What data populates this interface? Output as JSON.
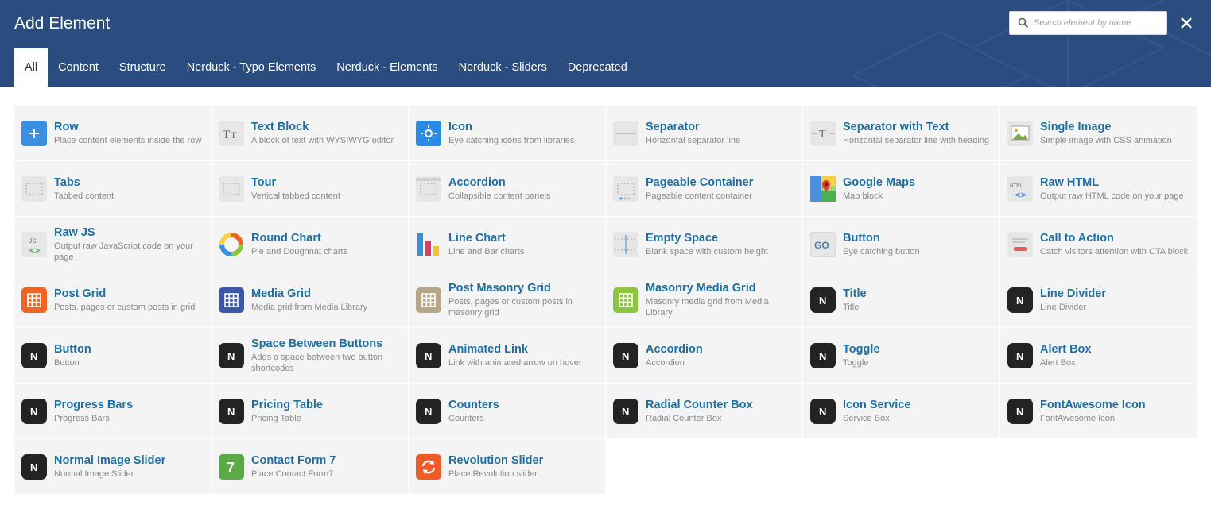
{
  "header": {
    "title": "Add Element",
    "search_placeholder": "Search element by name",
    "tabs": [
      "All",
      "Content",
      "Structure",
      "Nerduck - Typo Elements",
      "Nerduck - Elements",
      "Nerduck - Sliders",
      "Deprecated"
    ],
    "active_tab": "All",
    "background_color": "#2b4c7e"
  },
  "elements": [
    {
      "name": "Row",
      "desc": "Place content elements inside the row",
      "icon": "plus-icon",
      "color": "#3a8fe0"
    },
    {
      "name": "Text Block",
      "desc": "A block of text with WYSIWYG editor",
      "icon": "text-block-icon",
      "color": "#e6e6e6"
    },
    {
      "name": "Icon",
      "desc": "Eye catching icons from libraries",
      "icon": "sun-icon",
      "color": "#2a8be6"
    },
    {
      "name": "Separator",
      "desc": "Horizontal separator line",
      "icon": "separator-icon",
      "color": "#e6e6e6"
    },
    {
      "name": "Separator with Text",
      "desc": "Horizontal separator line with heading",
      "icon": "separator-text-icon",
      "color": "#e6e6e6"
    },
    {
      "name": "Single Image",
      "desc": "Simple image with CSS animation",
      "icon": "image-icon",
      "color": "#e6e6e6"
    },
    {
      "name": "Tabs",
      "desc": "Tabbed content",
      "icon": "tabs-icon",
      "color": "#e6e6e6"
    },
    {
      "name": "Tour",
      "desc": "Vertical tabbed content",
      "icon": "tour-icon",
      "color": "#e6e6e6"
    },
    {
      "name": "Accordion",
      "desc": "Collapsible content panels",
      "icon": "accordion-icon",
      "color": "#e6e6e6"
    },
    {
      "name": "Pageable Container",
      "desc": "Pageable content container",
      "icon": "pageable-icon",
      "color": "#e6e6e6"
    },
    {
      "name": "Google Maps",
      "desc": "Map block",
      "icon": "google-maps-icon",
      "color": "#4caf50"
    },
    {
      "name": "Raw HTML",
      "desc": "Output raw HTML code on your page",
      "icon": "html-icon",
      "color": "#e6e6e6"
    },
    {
      "name": "Raw JS",
      "desc": "Output raw JavaScript code on your page",
      "icon": "js-icon",
      "color": "#e6e6e6"
    },
    {
      "name": "Round Chart",
      "desc": "Pie and Doughnat charts",
      "icon": "round-chart-icon",
      "color": "#e6e6e6"
    },
    {
      "name": "Line Chart",
      "desc": "Line and Bar charts",
      "icon": "bar-chart-icon",
      "color": "#e6e6e6"
    },
    {
      "name": "Empty Space",
      "desc": "Blank space with custom height",
      "icon": "empty-space-icon",
      "color": "#e6e6e6"
    },
    {
      "name": "Button",
      "desc": "Eye catching button",
      "icon": "go-button-icon",
      "color": "#e6e6e6"
    },
    {
      "name": "Call to Action",
      "desc": "Catch visitors attention with CTA block",
      "icon": "cta-icon",
      "color": "#e6e6e6"
    },
    {
      "name": "Post Grid",
      "desc": "Posts, pages or custom posts in grid",
      "icon": "post-grid-icon",
      "color": "#f06424"
    },
    {
      "name": "Media Grid",
      "desc": "Media grid from Media Library",
      "icon": "media-grid-icon",
      "color": "#3b57a8"
    },
    {
      "name": "Post Masonry Grid",
      "desc": "Posts, pages or custom posts in masonry grid",
      "icon": "masonry-grid-icon",
      "color": "#b8a689"
    },
    {
      "name": "Masonry Media Grid",
      "desc": "Masonry media grid from Media Library",
      "icon": "masonry-media-grid-icon",
      "color": "#8cc63e"
    },
    {
      "name": "Title",
      "desc": "Title",
      "icon": "nerduck-icon",
      "color": "#232323"
    },
    {
      "name": "Line Divider",
      "desc": "Line Divider",
      "icon": "nerduck-icon",
      "color": "#232323"
    },
    {
      "name": "Button",
      "desc": "Button",
      "icon": "nerduck-icon",
      "color": "#232323"
    },
    {
      "name": "Space Between Buttons",
      "desc": "Adds a space between two button shortcodes",
      "icon": "nerduck-icon",
      "color": "#232323"
    },
    {
      "name": "Animated Link",
      "desc": "Link with animated arrow on hover",
      "icon": "nerduck-icon",
      "color": "#232323"
    },
    {
      "name": "Accordion",
      "desc": "Accordion",
      "icon": "nerduck-icon",
      "color": "#232323"
    },
    {
      "name": "Toggle",
      "desc": "Toggle",
      "icon": "nerduck-icon",
      "color": "#232323"
    },
    {
      "name": "Alert Box",
      "desc": "Alert Box",
      "icon": "nerduck-icon",
      "color": "#232323"
    },
    {
      "name": "Progress Bars",
      "desc": "Progress Bars",
      "icon": "nerduck-icon",
      "color": "#232323"
    },
    {
      "name": "Pricing Table",
      "desc": "Pricing Table",
      "icon": "nerduck-icon",
      "color": "#232323"
    },
    {
      "name": "Counters",
      "desc": "Counters",
      "icon": "nerduck-icon",
      "color": "#232323"
    },
    {
      "name": "Radial Counter Box",
      "desc": "Radial Counter Box",
      "icon": "nerduck-icon",
      "color": "#232323"
    },
    {
      "name": "Icon Service",
      "desc": "Service Box",
      "icon": "nerduck-icon",
      "color": "#232323"
    },
    {
      "name": "FontAwesome Icon",
      "desc": "FontAwesome Icon",
      "icon": "nerduck-icon",
      "color": "#232323"
    },
    {
      "name": "Normal Image Slider",
      "desc": "Normal Image Slider",
      "icon": "nerduck-icon",
      "color": "#232323"
    },
    {
      "name": "Contact Form 7",
      "desc": "Place Contact Form7",
      "icon": "contact-form-7-icon",
      "color": "#5ba846"
    },
    {
      "name": "Revolution Slider",
      "desc": "Place Revolution slider",
      "icon": "revolution-slider-icon",
      "color": "#f05a28"
    }
  ],
  "icon_glyphs": {
    "nerduck": "N",
    "go": "GO",
    "js": "JS",
    "html": "HTML",
    "cf7": "7"
  }
}
